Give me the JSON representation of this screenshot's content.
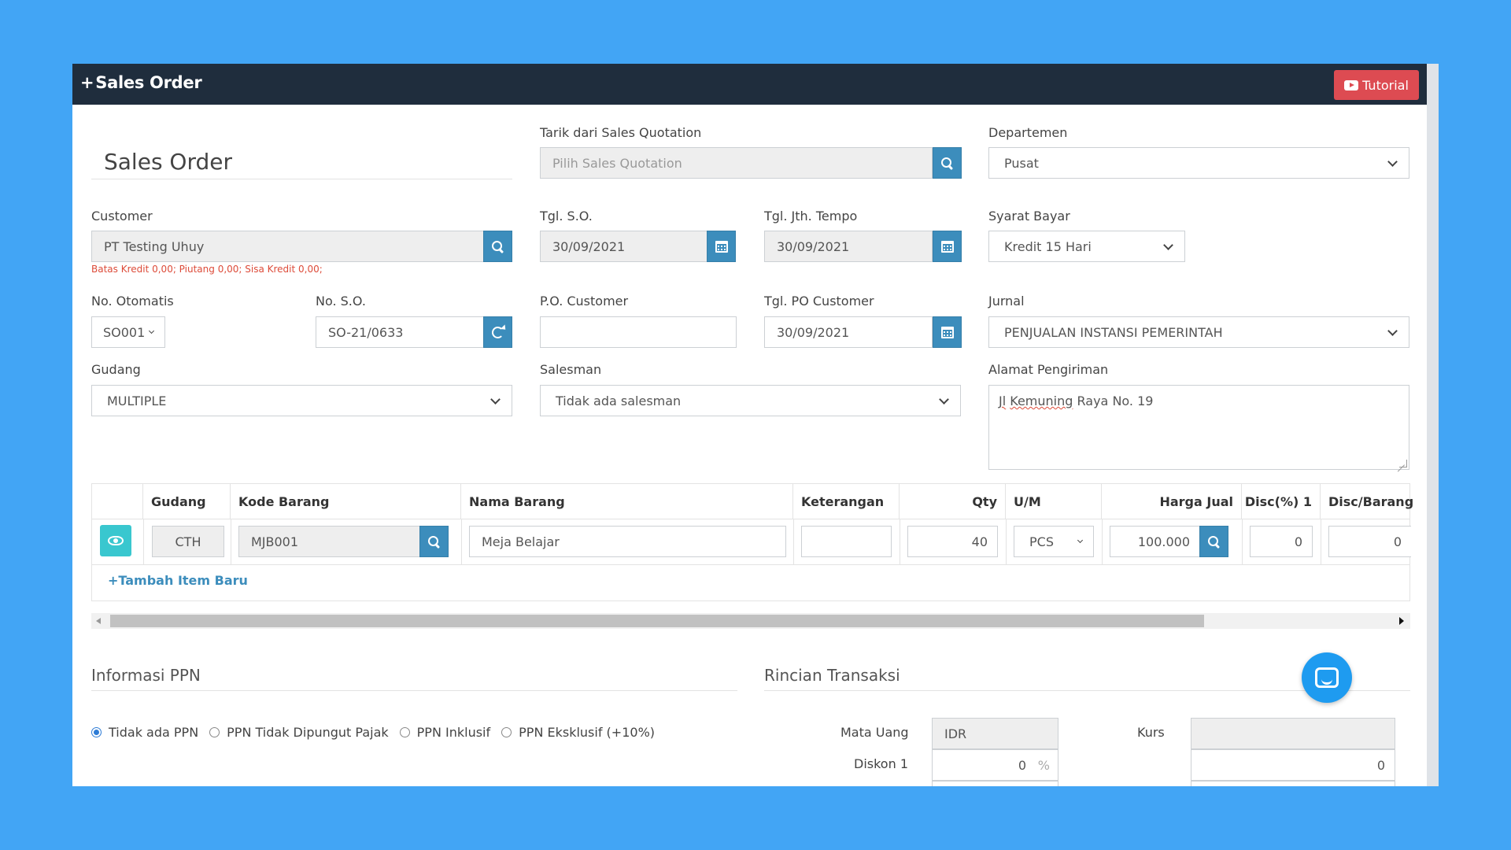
{
  "header": {
    "plus": "+",
    "title": "Sales Order",
    "tutorial_label": "Tutorial"
  },
  "form": {
    "heading": "Sales Order",
    "quotation": {
      "label": "Tarik dari Sales Quotation",
      "placeholder": "Pilih Sales Quotation"
    },
    "departemen": {
      "label": "Departemen",
      "value": "Pusat"
    },
    "customer": {
      "label": "Customer",
      "value": "PT Testing Uhuy",
      "credit_info": "Batas Kredit 0,00; Piutang 0,00; Sisa Kredit 0,00;"
    },
    "tgl_so": {
      "label": "Tgl. S.O.",
      "value": "30/09/2021"
    },
    "tgl_jth_tempo": {
      "label": "Tgl. Jth. Tempo",
      "value": "30/09/2021"
    },
    "syarat_bayar": {
      "label": "Syarat Bayar",
      "value": "Kredit 15 Hari"
    },
    "no_otomatis": {
      "label": "No. Otomatis",
      "value": "SO001"
    },
    "no_so": {
      "label": "No. S.O.",
      "value": "SO-21/0633"
    },
    "po_customer": {
      "label": "P.O. Customer",
      "value": ""
    },
    "tgl_po_customer": {
      "label": "Tgl. PO Customer",
      "value": "30/09/2021"
    },
    "jurnal": {
      "label": "Jurnal",
      "value": "PENJUALAN INSTANSI PEMERINTAH"
    },
    "gudang": {
      "label": "Gudang",
      "value": "MULTIPLE"
    },
    "salesman": {
      "label": "Salesman",
      "value": "Tidak ada salesman"
    },
    "alamat": {
      "label": "Alamat Pengiriman",
      "word1": "Jl",
      "word2": "Kemuning",
      "rest": "Raya No. 19"
    }
  },
  "items_table": {
    "columns": [
      "Gudang",
      "Kode Barang",
      "Nama Barang",
      "Keterangan",
      "Qty",
      "U/M",
      "Harga Jual",
      "Disc(%) 1",
      "Disc/Barang"
    ],
    "row": {
      "gudang": "CTH",
      "kode_barang": "MJB001",
      "nama_barang": "Meja Belajar",
      "keterangan": "",
      "qty": "40",
      "um": "PCS",
      "harga_jual": "100.000",
      "disc1": "0",
      "disc_barang": "0"
    },
    "add_item_label": "+Tambah Item Baru"
  },
  "ppn": {
    "title": "Informasi PPN",
    "options": [
      "Tidak ada PPN",
      "PPN Tidak Dipungut Pajak",
      "PPN Inklusif",
      "PPN Eksklusif (+10%)"
    ],
    "selected_index": 0
  },
  "rincian": {
    "title": "Rincian Transaksi",
    "mata_uang_label": "Mata Uang",
    "mata_uang_value": "IDR",
    "kurs_label": "Kurs",
    "kurs_value": "",
    "diskon1_label": "Diskon 1",
    "diskon1_value": "0",
    "diskon1_unit": "%",
    "diskon1_amount": "0"
  },
  "colors": {
    "accent": "#3c8dbc",
    "header_bg": "#1f2d3d",
    "tutorial_bg": "#dd4b52",
    "page_bg": "#42a5f5",
    "teal": "#39c7cf",
    "warning": "#dd4b39"
  }
}
